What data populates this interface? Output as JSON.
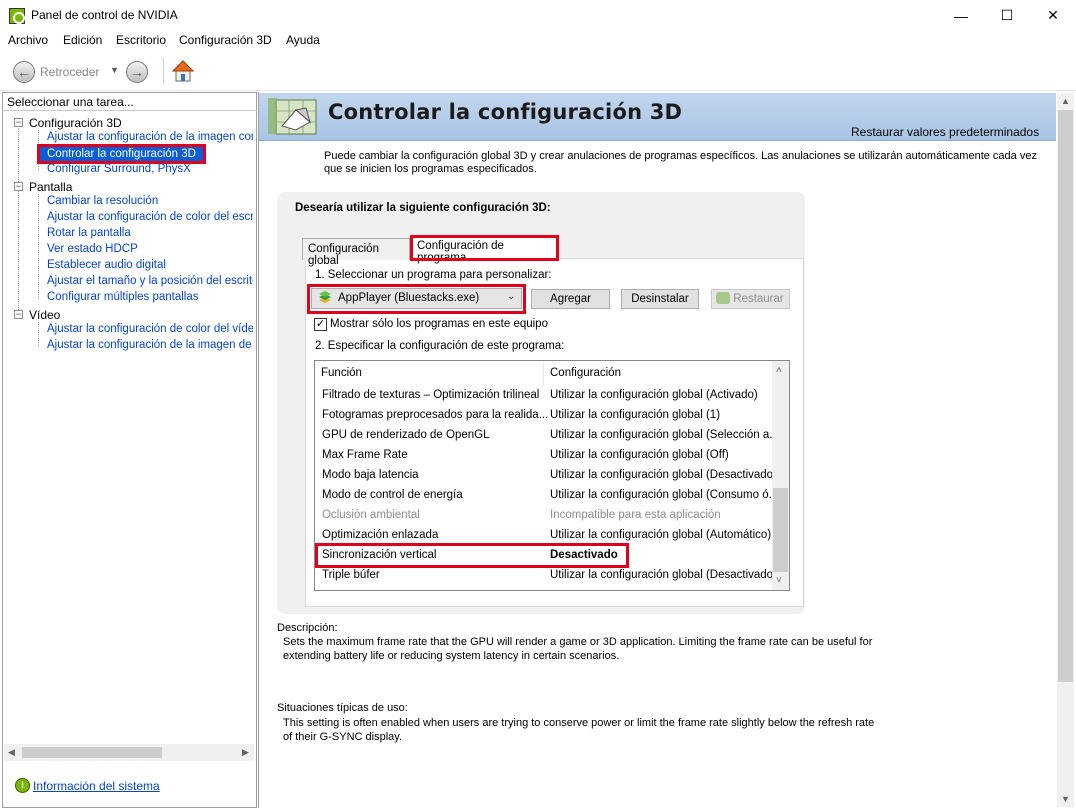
{
  "window": {
    "title": "Panel de control de NVIDIA",
    "controls": {
      "minimize": "—",
      "maximize": "☐",
      "close": "✕"
    }
  },
  "menu": [
    "Archivo",
    "Edición",
    "Escritorio",
    "Configuración 3D",
    "Ayuda"
  ],
  "toolbar": {
    "back_label": "Retroceder"
  },
  "sidebar": {
    "header": "Seleccionar una tarea...",
    "categories": [
      {
        "label": "Configuración 3D",
        "items": [
          "Ajustar la configuración de la imagen con v",
          "Controlar la configuración 3D",
          "Configurar Surround, PhysX"
        ]
      },
      {
        "label": "Pantalla",
        "items": [
          "Cambiar la resolución",
          "Ajustar la configuración de color del escrito",
          "Rotar la pantalla",
          "Ver estado HDCP",
          "Establecer audio digital",
          "Ajustar el tamaño y la posición del escritorio",
          "Configurar múltiples pantallas"
        ]
      },
      {
        "label": "Vídeo",
        "items": [
          "Ajustar la configuración de color del vídeo",
          "Ajustar la configuración de la imagen de víc"
        ]
      }
    ],
    "system_info": "Información del sistema"
  },
  "main": {
    "title": "Controlar la configuración 3D",
    "restore_defaults": "Restaurar valores predeterminados",
    "intro": "Puede cambiar la configuración global 3D y crear anulaciones de programas específicos. Las anulaciones se utilizarán automáticamente cada vez que se inicien los programas especificados.",
    "group_title": "Desearía utilizar la siguiente configuración 3D:",
    "tabs": [
      "Configuración global",
      "Configuración de programa"
    ],
    "step1": "1. Seleccionar un programa para personalizar:",
    "program_selected": "AppPlayer (Bluestacks.exe)",
    "buttons": {
      "add": "Agregar",
      "remove": "Desinstalar",
      "restore": "Restaurar"
    },
    "checkbox_label": "Mostrar sólo los programas en este equipo",
    "checkbox_checked": true,
    "step2": "2. Especificar la configuración de este programa:",
    "list_headers": {
      "function": "Función",
      "config": "Configuración"
    },
    "rows": [
      {
        "function": "Filtrado de texturas – Optimización trilineal",
        "config": "Utilizar la configuración global (Activado)"
      },
      {
        "function": "Fotogramas preprocesados para la realida...",
        "config": "Utilizar la configuración global (1)"
      },
      {
        "function": "GPU de renderizado de OpenGL",
        "config": "Utilizar la configuración global (Selección a..."
      },
      {
        "function": "Max Frame Rate",
        "config": "Utilizar la configuración global (Off)"
      },
      {
        "function": "Modo baja latencia",
        "config": "Utilizar la configuración global (Desactivado)"
      },
      {
        "function": "Modo de control de energía",
        "config": "Utilizar la configuración global (Consumo ó..."
      },
      {
        "function": "Oclusión ambiental",
        "config": "Incompatible para esta aplicación"
      },
      {
        "function": "Optimización enlazada",
        "config": "Utilizar la configuración global (Automático)"
      },
      {
        "function": "Sincronización vertical",
        "config": "Desactivado"
      },
      {
        "function": "Triple búfer",
        "config": "Utilizar la configuración global (Desactivado)"
      }
    ],
    "description_head": "Descripción:",
    "description": "Sets the maximum frame rate that the GPU will render a game or 3D application. Limiting the frame rate can be useful for extending battery life or reducing system latency in certain scenarios.",
    "usage_head": "Situaciones típicas de uso:",
    "usage": "This setting is often enabled when users are trying to conserve power or limit the frame rate slightly below the refresh rate of their G-SYNC display."
  },
  "colors": {
    "accent_green": "#76b900",
    "highlight_red": "#e0001b",
    "link_blue": "#0645c8",
    "banner_blue": "#b4cde9"
  }
}
